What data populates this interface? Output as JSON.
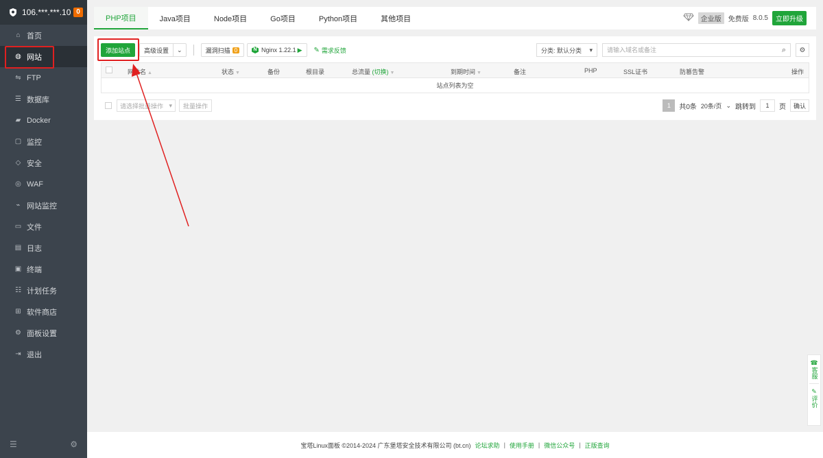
{
  "server": {
    "name": "106.***.***.10",
    "alert_count": "0"
  },
  "sidebar": {
    "items": [
      {
        "label": "首页",
        "icon": "home-icon"
      },
      {
        "label": "网站",
        "icon": "globe-icon"
      },
      {
        "label": "FTP",
        "icon": "ftp-icon"
      },
      {
        "label": "数据库",
        "icon": "database-icon"
      },
      {
        "label": "Docker",
        "icon": "docker-icon"
      },
      {
        "label": "监控",
        "icon": "monitor-icon"
      },
      {
        "label": "安全",
        "icon": "shield-icon"
      },
      {
        "label": "WAF",
        "icon": "waf-icon"
      },
      {
        "label": "网站监控",
        "icon": "site-monitor-icon"
      },
      {
        "label": "文件",
        "icon": "folder-icon"
      },
      {
        "label": "日志",
        "icon": "log-icon"
      },
      {
        "label": "终端",
        "icon": "terminal-icon"
      },
      {
        "label": "计划任务",
        "icon": "task-icon"
      },
      {
        "label": "软件商店",
        "icon": "store-icon"
      },
      {
        "label": "面板设置",
        "icon": "settings-icon"
      },
      {
        "label": "退出",
        "icon": "logout-icon"
      }
    ],
    "active_index": 1
  },
  "tabs": [
    "PHP项目",
    "Java项目",
    "Node项目",
    "Go项目",
    "Python项目",
    "其他项目"
  ],
  "top_right": {
    "enterprise": "企业版",
    "free": "免费版",
    "version": "8.0.5",
    "upgrade": "立即升级"
  },
  "toolbar": {
    "add_site": "添加站点",
    "advanced": "高级设置",
    "vuln_scan": "漏洞扫描",
    "vuln_count": "0",
    "nginx": "Nginx 1.22.1",
    "feedback": "需求反馈",
    "category": "分类: 默认分类",
    "search_placeholder": "请输入域名或备注"
  },
  "table": {
    "headers": {
      "name": "网站名",
      "status": "状态",
      "backup": "备份",
      "root": "根目录",
      "traffic": "总流量",
      "traffic_switch": "(切换)",
      "expire": "到期时间",
      "remark": "备注",
      "php": "PHP",
      "ssl": "SSL证书",
      "alert": "防篡告警",
      "action": "操作"
    },
    "empty_text": "站点列表为空"
  },
  "bulk": {
    "select_placeholder": "请选择批量操作",
    "button": "批量操作"
  },
  "pager": {
    "current": "1",
    "total": "共0条",
    "size": "20条/页",
    "jump_label": "跳转到",
    "jump_value": "1",
    "page_unit": "页",
    "ok": "确认"
  },
  "footer": {
    "copyright": "宝塔Linux面板 ©2014-2024 广东堡塔安全技术有限公司 (bt.cn)",
    "links": [
      "论坛求助",
      "使用手册",
      "微信公众号",
      "正版查询"
    ]
  },
  "float_widget": {
    "service": "客服",
    "review": "评价"
  },
  "colors": {
    "accent": "#20a53a",
    "sidebar": "#3c444d",
    "highlight": "#e02020",
    "badge": "#ef6c00"
  }
}
